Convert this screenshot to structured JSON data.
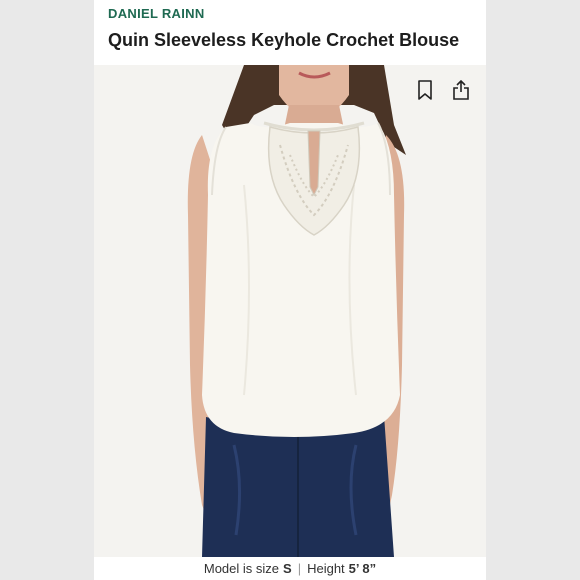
{
  "header": {
    "brand": "DANIEL RAINN",
    "title": "Quin Sleeveless Keyhole Crochet Blouse"
  },
  "actions": {
    "bookmark_icon": "bookmark-icon",
    "share_icon": "share-icon"
  },
  "caption": {
    "size_label": "Model is size",
    "size_value": "S",
    "separator": "|",
    "height_label": "Height",
    "height_value": "5’ 8”"
  },
  "colors": {
    "brand": "#1f6a52",
    "blouse": "#f7f5ef",
    "denim": "#1e2f55",
    "hair": "#4a3426",
    "skin": "#e2b79f"
  }
}
